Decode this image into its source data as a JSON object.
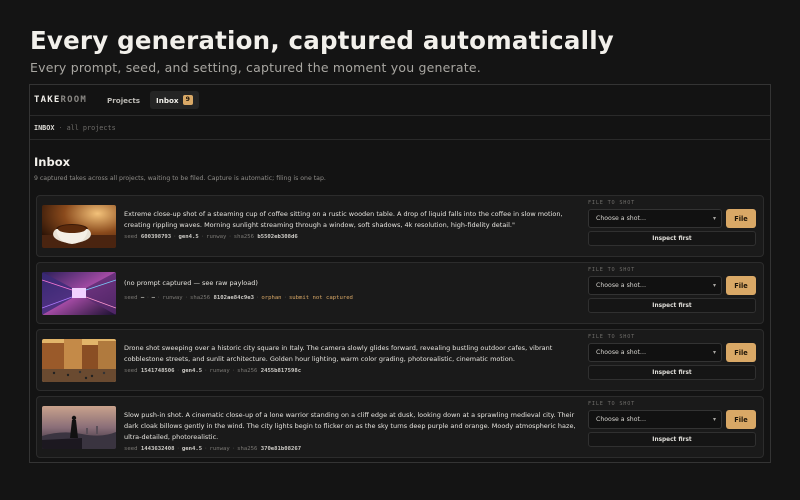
{
  "hero": {
    "title": "Every generation, captured automatically",
    "subtitle": "Every prompt, seed, and setting, captured the moment you generate."
  },
  "app": {
    "brand_primary": "TAKE",
    "brand_secondary": "ROOM",
    "nav": [
      {
        "label": "Projects",
        "active": false
      },
      {
        "label": "Inbox",
        "active": true,
        "badge": "9"
      }
    ],
    "breadcrumb": {
      "current": "INBOX",
      "separator": "·",
      "rest": "all projects"
    },
    "page_title": "Inbox",
    "page_description": "9 captured takes across all projects, waiting to be filed. Capture is automatic; filing is one tap.",
    "file_label": "FILE TO SHOT",
    "select_placeholder": "Choose a shot…",
    "file_button": "File",
    "inspect_button": "Inspect first",
    "accent_color": "#d9a866",
    "items": [
      {
        "thumbnail": "coffee-cup",
        "prompt": "Extreme close-up shot of a steaming cup of coffee sitting on a rustic wooden table. A drop of liquid falls into the coffee in slow motion, creating rippling waves. Morning sunlight streaming through a window, soft shadows, 4k resolution, high-fidelity detail.\"",
        "meta": {
          "seed_label": "seed",
          "seed": "600398793",
          "model": "gen4.5",
          "provider": "runway",
          "hash_label": "sha256",
          "hash": "b5502eb308d6"
        }
      },
      {
        "thumbnail": "neon-corridor",
        "prompt": "(no prompt captured — see raw payload)",
        "meta": {
          "seed_label": "seed",
          "seed": "—",
          "model": "—",
          "provider": "runway",
          "hash_label": "sha256",
          "hash": "8102ae84c9e3",
          "flag": "orphan",
          "flag2": "submit not captured"
        }
      },
      {
        "thumbnail": "city-square",
        "prompt": "Drone shot sweeping over a historic city square in Italy. The camera slowly glides forward, revealing bustling outdoor cafes, vibrant cobblestone streets, and sunlit architecture. Golden hour lighting, warm color grading, photorealistic, cinematic motion.",
        "meta": {
          "seed_label": "seed",
          "seed": "1541748506",
          "model": "gen4.5",
          "provider": "runway",
          "hash_label": "sha256",
          "hash": "2455b817598c"
        }
      },
      {
        "thumbnail": "warrior-cliff",
        "prompt": "Slow push-in shot. A cinematic close-up of a lone warrior standing on a cliff edge at dusk, looking down at a sprawling medieval city. Their dark cloak billows gently in the wind. The city lights begin to flicker on as the sky turns deep purple and orange. Moody atmospheric haze, ultra-detailed, photorealistic.",
        "meta": {
          "seed_label": "seed",
          "seed": "1443632408",
          "model": "gen4.5",
          "provider": "runway",
          "hash_label": "sha256",
          "hash": "370e81b08267"
        }
      }
    ]
  }
}
